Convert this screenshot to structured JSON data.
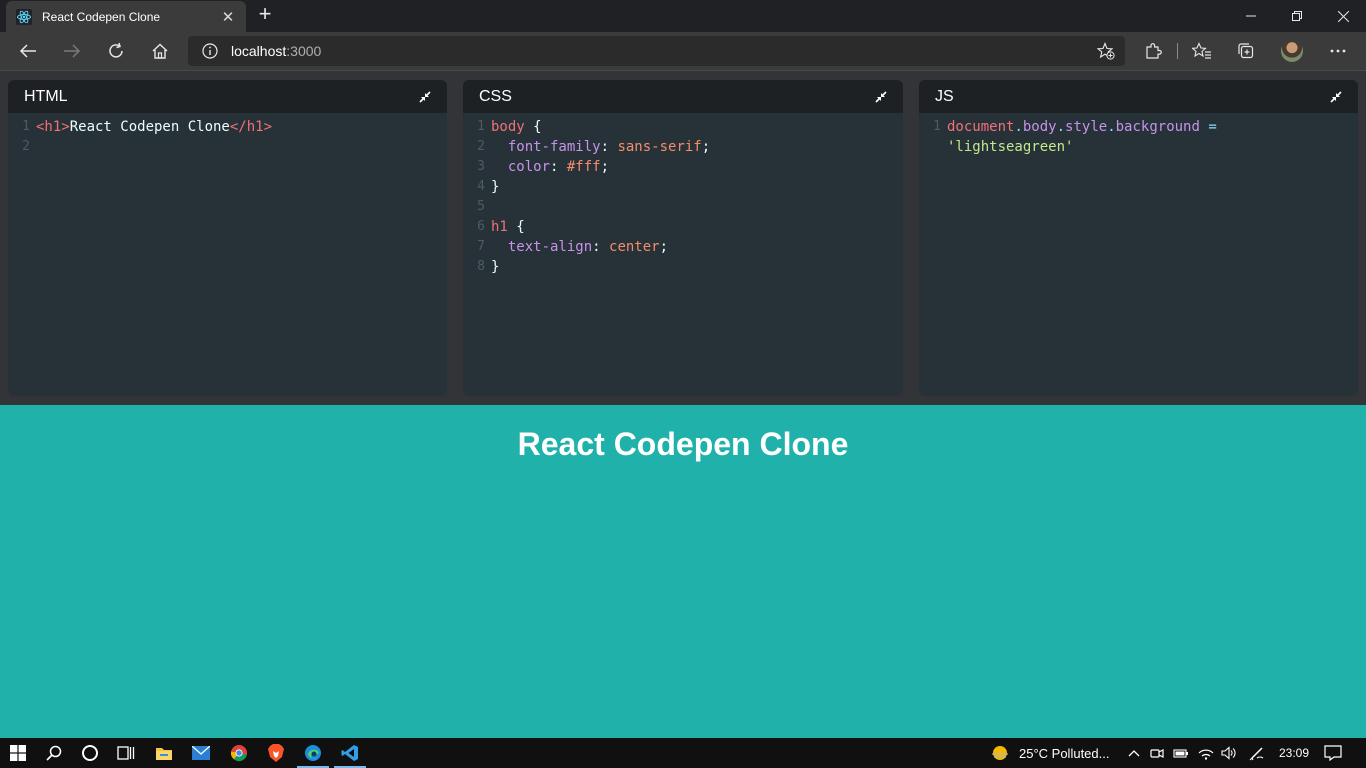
{
  "browser": {
    "tab_title": "React Codepen Clone",
    "tab_close": "✕",
    "new_tab": "+",
    "url_host": "localhost",
    "url_port": ":3000"
  },
  "editors": [
    {
      "title": "HTML"
    },
    {
      "title": "CSS"
    },
    {
      "title": "JS"
    }
  ],
  "code": {
    "html": {
      "line_numbers": [
        "1",
        "2"
      ],
      "l1_open": "<h1>",
      "l1_text": "React Codepen Clone",
      "l1_close": "</h1>"
    },
    "css": {
      "line_numbers": [
        "1",
        "2",
        "3",
        "4",
        "5",
        "6",
        "7",
        "8"
      ],
      "l1_sel": "body",
      "l1_brace": " {",
      "l2_prop": "font-family",
      "l2_colon": ": ",
      "l2_val": "sans-serif",
      "l2_semi": ";",
      "l3_prop": "color",
      "l3_colon": ": ",
      "l3_val": "#fff",
      "l3_semi": ";",
      "l4_brace": "}",
      "l6_sel": "h1",
      "l6_brace": " {",
      "l7_prop": "text-align",
      "l7_colon": ": ",
      "l7_val": "center",
      "l7_semi": ";",
      "l8_brace": "}"
    },
    "js": {
      "line_numbers": [
        "1"
      ],
      "obj": "document",
      "dot1": ".",
      "p1": "body",
      "dot2": ".",
      "p2": "style",
      "dot3": ".",
      "p3": "background",
      "op": " =",
      "str": "'lightseagreen'"
    }
  },
  "preview": {
    "heading": "React Codepen Clone",
    "background": "#20b2aa"
  },
  "taskbar": {
    "weather": "25°C  Polluted...",
    "time": "23:09"
  }
}
